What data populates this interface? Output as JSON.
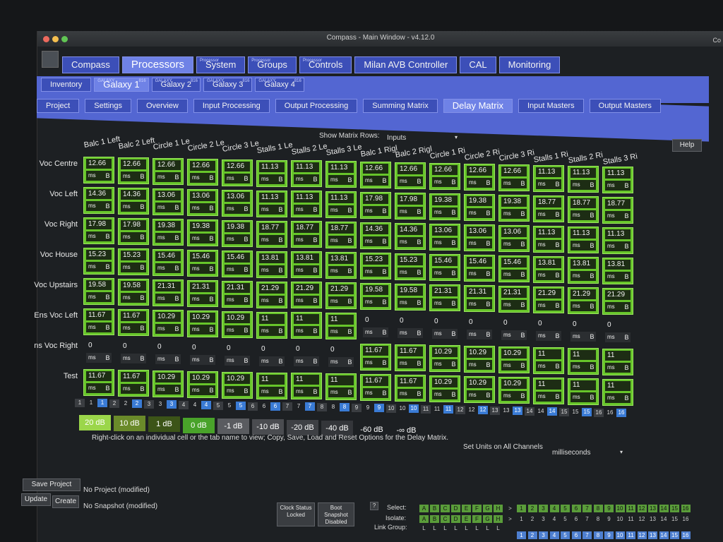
{
  "window": {
    "title": "Compass - Main Window - v4.12.0",
    "right_label": "Co"
  },
  "main_tabs": [
    {
      "label": "Compass",
      "sup": ""
    },
    {
      "label": "Processors",
      "sup": ""
    },
    {
      "label": "System",
      "sup": "Processor"
    },
    {
      "label": "Groups",
      "sup": "Processor"
    },
    {
      "label": "Controls",
      "sup": "Processor"
    },
    {
      "label": "Milan AVB Controller",
      "sup": ""
    },
    {
      "label": "CAL",
      "sup": ""
    },
    {
      "label": "Monitoring",
      "sup": ""
    }
  ],
  "device_tabs": [
    {
      "label": "Inventory",
      "sup": "",
      "sup2": ""
    },
    {
      "label": "Galaxy 1",
      "sup": "GALAXY",
      "sup2": "816"
    },
    {
      "label": "Galaxy 2",
      "sup": "GALAXY",
      "sup2": "816"
    },
    {
      "label": "Galaxy 3",
      "sup": "GALAXY",
      "sup2": "816"
    },
    {
      "label": "Galaxy 4",
      "sup": "GALAXY",
      "sup2": "816"
    }
  ],
  "sub_tabs": [
    "Project",
    "Settings",
    "Overview",
    "Input Processing",
    "Output Processing",
    "Summing Matrix",
    "Delay Matrix",
    "Input Masters",
    "Output Masters"
  ],
  "matrix_rows_label": "Show Matrix Rows:",
  "matrix_rows_value": "Inputs",
  "help_label": "Help",
  "columns": [
    "Balc 1 Left",
    "Balc 2 Left",
    "Circle 1 Le",
    "Circle 2 Le",
    "Circle 3 Le",
    "Stalls 1 Le",
    "Stalls 2 Le",
    "Stalls 3 Le",
    "Balc 1 Rigl",
    "Balc 2 Rigl",
    "Circle 1 Ri",
    "Circle 2 Ri",
    "Circle 3 Ri",
    "Stalls 1 Ri",
    "Stalls 2 Ri",
    "Stalls 3 Ri"
  ],
  "rows": [
    {
      "label": "Voc Centre",
      "values": [
        "12.66",
        "12.66",
        "12.66",
        "12.66",
        "12.66",
        "11.13",
        "11.13",
        "11.13",
        "12.66",
        "12.66",
        "12.66",
        "12.66",
        "12.66",
        "11.13",
        "11.13",
        "11.13"
      ]
    },
    {
      "label": "Voc Left",
      "values": [
        "14.36",
        "14.36",
        "13.06",
        "13.06",
        "13.06",
        "11.13",
        "11.13",
        "11.13",
        "17.98",
        "17.98",
        "19.38",
        "19.38",
        "19.38",
        "18.77",
        "18.77",
        "18.77"
      ]
    },
    {
      "label": "Voc Right",
      "values": [
        "17.98",
        "17.98",
        "19.38",
        "19.38",
        "19.38",
        "18.77",
        "18.77",
        "18.77",
        "14.36",
        "14.36",
        "13.06",
        "13.06",
        "13.06",
        "11.13",
        "11.13",
        "11.13"
      ]
    },
    {
      "label": "Voc House",
      "values": [
        "15.23",
        "15.23",
        "15.46",
        "15.46",
        "15.46",
        "13.81",
        "13.81",
        "13.81",
        "15.23",
        "15.23",
        "15.46",
        "15.46",
        "15.46",
        "13.81",
        "13.81",
        "13.81"
      ]
    },
    {
      "label": "Voc Upstairs",
      "values": [
        "19.58",
        "19.58",
        "21.31",
        "21.31",
        "21.31",
        "21.29",
        "21.29",
        "21.29",
        "19.58",
        "19.58",
        "21.31",
        "21.31",
        "21.31",
        "21.29",
        "21.29",
        "21.29"
      ]
    },
    {
      "label": "Ens Voc Left",
      "values": [
        "11.67",
        "11.67",
        "10.29",
        "10.29",
        "10.29",
        "11",
        "11",
        "11",
        "0",
        "0",
        "0",
        "0",
        "0",
        "0",
        "0",
        "0"
      ],
      "active": [
        1,
        1,
        1,
        1,
        1,
        1,
        1,
        1,
        0,
        0,
        0,
        0,
        0,
        0,
        0,
        0
      ]
    },
    {
      "label": "ns Voc Right",
      "values": [
        "0",
        "0",
        "0",
        "0",
        "0",
        "0",
        "0",
        "0",
        "11.67",
        "11.67",
        "10.29",
        "10.29",
        "10.29",
        "11",
        "11",
        "11"
      ],
      "active": [
        0,
        0,
        0,
        0,
        0,
        0,
        0,
        0,
        1,
        1,
        1,
        1,
        1,
        1,
        1,
        1
      ]
    },
    {
      "label": "Test",
      "values": [
        "11.67",
        "11.67",
        "10.29",
        "10.29",
        "10.29",
        "11",
        "11",
        "11",
        "11.67",
        "11.67",
        "10.29",
        "10.29",
        "10.29",
        "11",
        "11",
        "11"
      ]
    }
  ],
  "unit_label": "ms",
  "b_label": "B",
  "channel_numbers": [
    "1",
    "2",
    "3",
    "4",
    "5",
    "6",
    "7",
    "8",
    "9",
    "10",
    "11",
    "12",
    "13",
    "14",
    "15",
    "16"
  ],
  "gains": [
    {
      "label": "20 dB",
      "bg": "#9bd64a",
      "fg": "#ffffff"
    },
    {
      "label": "10 dB",
      "bg": "#6a8a2a",
      "fg": "#ffffff"
    },
    {
      "label": "1 dB",
      "bg": "#3c5418",
      "fg": "#ffffff"
    },
    {
      "label": "0 dB",
      "bg": "#49a32a",
      "fg": "#ffffff"
    },
    {
      "label": "-1 dB",
      "bg": "#5a5c60",
      "fg": "#ffffff"
    },
    {
      "label": "-10 dB",
      "bg": "#4a4c50",
      "fg": "#ffffff"
    },
    {
      "label": "-20 dB",
      "bg": "#3e4044",
      "fg": "#ffffff"
    },
    {
      "label": "-40 dB",
      "bg": "#34363a",
      "fg": "#ffffff"
    },
    {
      "label": "-60 dB",
      "bg": "#1d2023",
      "fg": "#ffffff"
    },
    {
      "label": "-∞ dB",
      "bg": "#1d2023",
      "fg": "#ffffff"
    }
  ],
  "hint_text": "Right-click on an individual cell or the tab name to view; Copy, Save, Load and Reset Options for the Delay Matrix.",
  "units_label": "Set Units on All Channels",
  "units_value": "milliseconds",
  "footer": {
    "save_project": "Save Project",
    "no_project": "No Project (modified)",
    "update": "Update",
    "create": "Create",
    "no_snapshot": "No Snapshot (modified)",
    "clock_status": "Clock Status Locked",
    "boot_snapshot": "Boot Snapshot Disabled",
    "help_q": "?",
    "select": "Select:",
    "isolate": "Isolate:",
    "link_group": "Link Group:",
    "letters": [
      "A",
      "B",
      "C",
      "D",
      "E",
      "F",
      "G",
      "H"
    ],
    "link_letters": [
      "L",
      "L",
      "L",
      "L",
      "L",
      "L",
      "L",
      "L"
    ],
    "arrow": ">",
    "numbers": [
      "1",
      "2",
      "3",
      "4",
      "5",
      "6",
      "7",
      "8",
      "9",
      "10",
      "11",
      "12",
      "13",
      "14",
      "15",
      "16"
    ]
  },
  "colors": {
    "accent": "#5366d2",
    "cell_green": "#67c52a",
    "channel_blue": "#3a7bd5"
  }
}
